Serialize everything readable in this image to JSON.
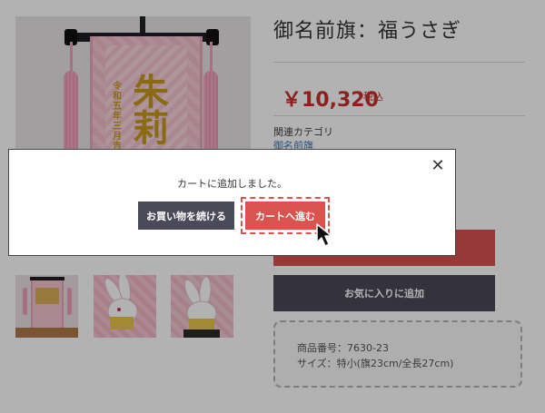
{
  "product": {
    "title": "御名前旗：福うさぎ",
    "price": "￥10,320",
    "tax_label": "税込",
    "category_label": "関連カテゴリ",
    "category_link": "御名前旗",
    "banner_name": "朱莉",
    "banner_sub": "令和五年三月吉日"
  },
  "actions": {
    "favorite_label": "お気に入りに追加"
  },
  "specs": {
    "code": "商品番号：7630-23",
    "size": "サイズ：特小(旗23cm/全長27cm)"
  },
  "modal": {
    "message": "カートに追加しました。",
    "continue_label": "お買い物を続ける",
    "checkout_label": "カートへ進む",
    "close_label": "✕"
  },
  "colors": {
    "accent_red": "#d9534f",
    "dark_button": "#4b4a58",
    "link_blue": "#3d74b8"
  }
}
